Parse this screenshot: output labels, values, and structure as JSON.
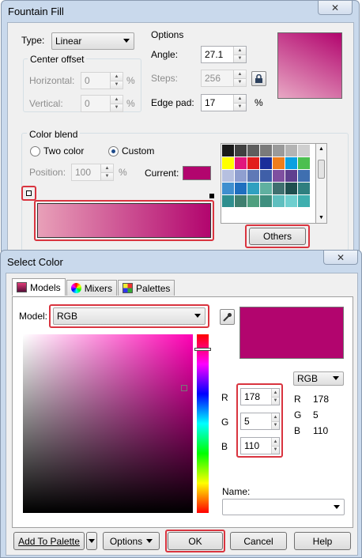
{
  "fountain": {
    "title": "Fountain Fill",
    "close": "✕",
    "type_label": "Type:",
    "type_value": "Linear",
    "options_label": "Options",
    "angle_label": "Angle:",
    "angle_value": "27.1",
    "steps_label": "Steps:",
    "steps_value": "256",
    "edgepad_label": "Edge pad:",
    "edgepad_value": "17",
    "percent": "%",
    "center_offset_label": "Center offset",
    "horizontal_label": "Horizontal:",
    "horizontal_value": "0",
    "vertical_label": "Vertical:",
    "vertical_value": "0",
    "color_blend_label": "Color blend",
    "two_color_label": "Two color",
    "custom_label": "Custom",
    "position_label": "Position:",
    "position_value": "100",
    "current_label": "Current:",
    "others_label": "Others",
    "current_color": "#b2056e",
    "palette": [
      "#1a1a1a",
      "#404040",
      "#5e5e5e",
      "#7a7a7a",
      "#9a9a9a",
      "#b4b4b4",
      "#cfcfcf",
      "#ffffff",
      "#ffff00",
      "#e2167d",
      "#e21d1d",
      "#1a2d9a",
      "#ef7d1a",
      "#0ba0e0",
      "#4cbf50",
      "#3f8f2f",
      "#b6c0e0",
      "#8f9fd0",
      "#5f79b6",
      "#3f5fa8",
      "#7f4fa0",
      "#5f3f8f",
      "#3f6fb0",
      "#7f7fb0",
      "#3f8fcf",
      "#1f6fbf",
      "#2fa0c0",
      "#5fb0a0",
      "#3f6f6f",
      "#1f4f4f",
      "#2f7f7f",
      "#5f9f9f",
      "#2f8f8f",
      "#3f7f6f",
      "#4f9f7f",
      "#3f8f7f",
      "#5fbfbf",
      "#6fcfcf",
      "#3fafaf",
      "#4f8f9f"
    ]
  },
  "select_color": {
    "title": "Select Color",
    "close": "✕",
    "tabs": [
      {
        "label": "Models",
        "icon": "models-icon"
      },
      {
        "label": "Mixers",
        "icon": "mixers-icon"
      },
      {
        "label": "Palettes",
        "icon": "palettes-icon"
      }
    ],
    "model_label": "Model:",
    "model_value": "RGB",
    "color_space": "RGB",
    "r_label": "R",
    "r_value": "178",
    "g_label": "G",
    "g_value": "5",
    "b_label": "B",
    "b_value": "110",
    "ref_r_label": "R",
    "ref_r_value": "178",
    "ref_g_label": "G",
    "ref_g_value": "5",
    "ref_b_label": "B",
    "ref_b_value": "110",
    "name_label": "Name:",
    "name_value": "",
    "swatch_color": "#b2056e",
    "add_to_palette": "Add To Palette",
    "options": "Options",
    "ok": "OK",
    "cancel": "Cancel",
    "help": "Help"
  }
}
